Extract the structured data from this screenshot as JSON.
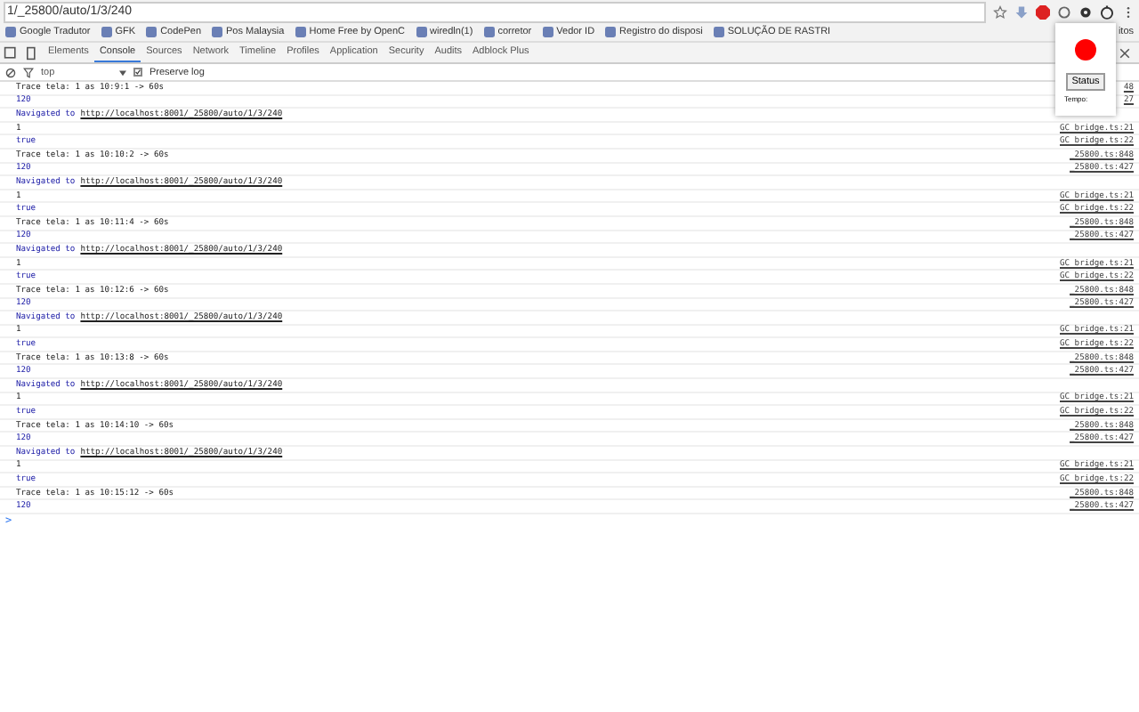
{
  "address_bar": {
    "url": "1/_25800/auto/1/3/240"
  },
  "bookmarks": [
    {
      "label": "Google Tradutor"
    },
    {
      "label": "GFK"
    },
    {
      "label": "CodePen"
    },
    {
      "label": "Pos Malaysia"
    },
    {
      "label": "Home Free by OpenC"
    },
    {
      "label": "wiredln(1)"
    },
    {
      "label": "corretor"
    },
    {
      "label": "Vedor ID"
    },
    {
      "label": "Registro do disposi"
    },
    {
      "label": "SOLUÇÃO DE RASTRI"
    }
  ],
  "bookmarks_overflow": "itos",
  "devtools_tabs": [
    {
      "label": "Elements",
      "selected": false
    },
    {
      "label": "Console",
      "selected": true
    },
    {
      "label": "Sources",
      "selected": false
    },
    {
      "label": "Network",
      "selected": false
    },
    {
      "label": "Timeline",
      "selected": false
    },
    {
      "label": "Profiles",
      "selected": false
    },
    {
      "label": "Application",
      "selected": false
    },
    {
      "label": "Security",
      "selected": false
    },
    {
      "label": "Audits",
      "selected": false
    },
    {
      "label": "Adblock Plus",
      "selected": false
    }
  ],
  "filter": {
    "context": "top",
    "preserve_log": {
      "label": "Preserve log",
      "checked": true
    }
  },
  "console": [
    {
      "kind": "log",
      "text": "Trace tela: 1 as 10:9:1 -> 60s",
      "source": "48"
    },
    {
      "kind": "number",
      "text": "120",
      "source": "27"
    },
    {
      "kind": "nav",
      "label": "Navigated to",
      "url": "http://localhost:8001/_25800/auto/1/3/240"
    },
    {
      "kind": "log",
      "text": "1",
      "source": "GC bridge.ts:21"
    },
    {
      "kind": "number",
      "text": "true",
      "source": "GC bridge.ts:22"
    },
    {
      "kind": "log",
      "text": "Trace tela: 1 as 10:10:2 -> 60s",
      "source": "_25800.ts:848"
    },
    {
      "kind": "number",
      "text": "120",
      "source": "_25800.ts:427"
    },
    {
      "kind": "nav",
      "label": "Navigated to",
      "url": "http://localhost:8001/_25800/auto/1/3/240"
    },
    {
      "kind": "log",
      "text": "1",
      "source": "GC bridge.ts:21"
    },
    {
      "kind": "number",
      "text": "true",
      "source": "GC bridge.ts:22"
    },
    {
      "kind": "log",
      "text": "Trace tela: 1 as 10:11:4 -> 60s",
      "source": "_25800.ts:848"
    },
    {
      "kind": "number",
      "text": "120",
      "source": "_25800.ts:427"
    },
    {
      "kind": "nav",
      "label": "Navigated to",
      "url": "http://localhost:8001/_25800/auto/1/3/240"
    },
    {
      "kind": "log",
      "text": "1",
      "source": "GC bridge.ts:21"
    },
    {
      "kind": "number",
      "text": "true",
      "source": "GC bridge.ts:22"
    },
    {
      "kind": "log",
      "text": "Trace tela: 1 as 10:12:6 -> 60s",
      "source": "_25800.ts:848"
    },
    {
      "kind": "number",
      "text": "120",
      "source": "_25800.ts:427"
    },
    {
      "kind": "nav",
      "label": "Navigated to",
      "url": "http://localhost:8001/_25800/auto/1/3/240"
    },
    {
      "kind": "log",
      "text": "1",
      "source": "GC bridge.ts:21"
    },
    {
      "kind": "number",
      "text": "true",
      "source": "GC bridge.ts:22"
    },
    {
      "kind": "log",
      "text": "Trace tela: 1 as 10:13:8 -> 60s",
      "source": "_25800.ts:848"
    },
    {
      "kind": "number",
      "text": "120",
      "source": "_25800.ts:427"
    },
    {
      "kind": "nav",
      "label": "Navigated to",
      "url": "http://localhost:8001/_25800/auto/1/3/240"
    },
    {
      "kind": "log",
      "text": "1",
      "source": "GC bridge.ts:21"
    },
    {
      "kind": "number",
      "text": "true",
      "source": "GC bridge.ts:22"
    },
    {
      "kind": "log",
      "text": "Trace tela: 1 as 10:14:10 -> 60s",
      "source": "_25800.ts:848"
    },
    {
      "kind": "number",
      "text": "120",
      "source": "_25800.ts:427"
    },
    {
      "kind": "nav",
      "label": "Navigated to",
      "url": "http://localhost:8001/_25800/auto/1/3/240"
    },
    {
      "kind": "log",
      "text": "1",
      "source": "GC bridge.ts:21"
    },
    {
      "kind": "number",
      "text": "true",
      "source": "GC bridge.ts:22"
    },
    {
      "kind": "log",
      "text": "Trace tela: 1 as 10:15:12 -> 60s",
      "source": "_25800.ts:848"
    },
    {
      "kind": "number",
      "text": "120",
      "source": "_25800.ts:427"
    }
  ],
  "console_prompt": ">",
  "popup": {
    "recording": true,
    "button": "Status",
    "label": "Tempo:"
  }
}
